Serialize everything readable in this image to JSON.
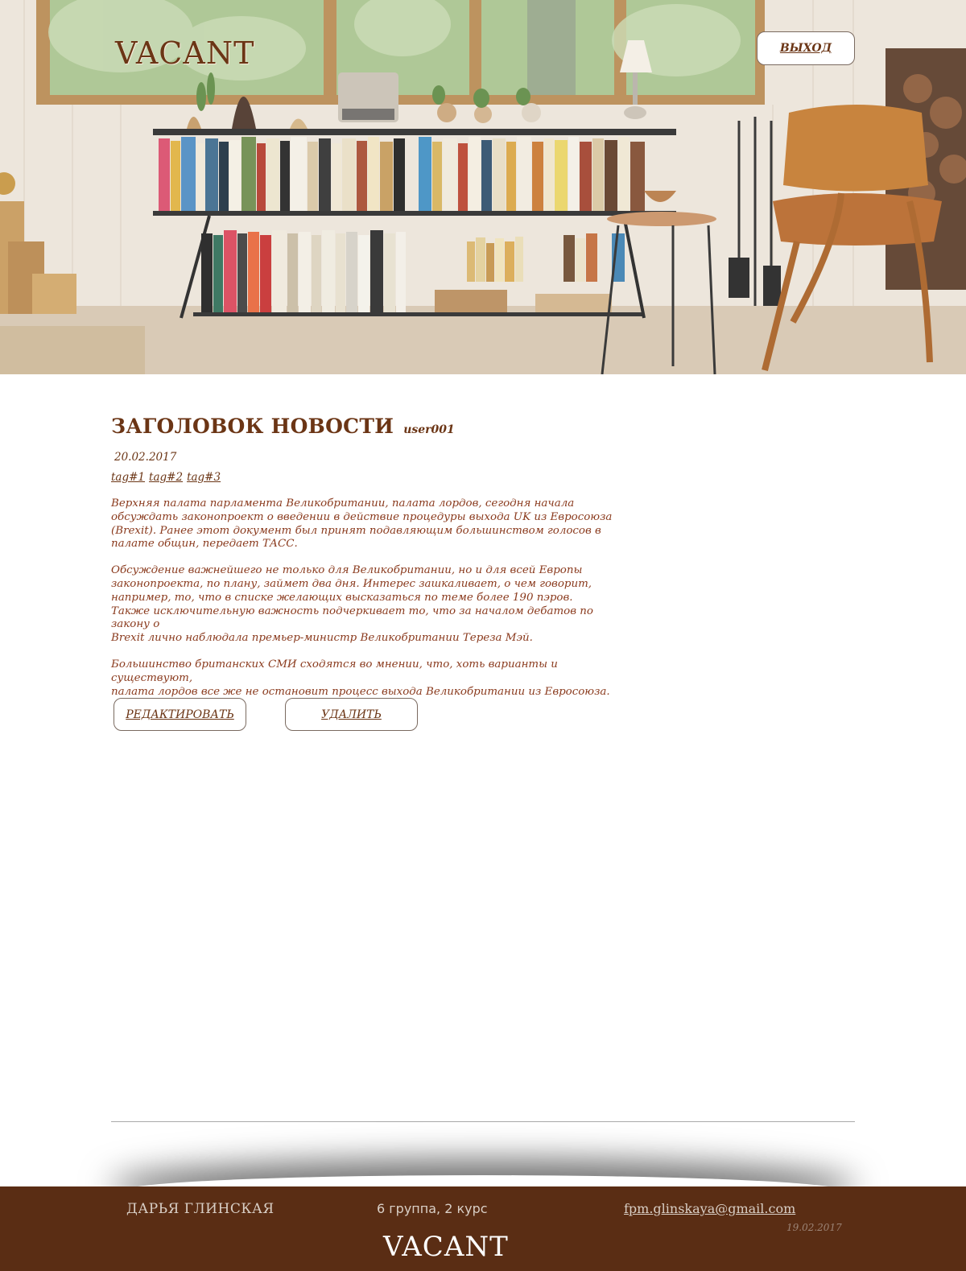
{
  "header": {
    "logo": "VACANT",
    "logout_label": "ВЫХОД"
  },
  "article": {
    "title": "ЗАГОЛОВОК НОВОСТИ",
    "author": "user001",
    "date": "20.02.2017",
    "tags": [
      "tag#1",
      "tag#2",
      "tag#3"
    ],
    "paragraphs": [
      "Верхняя палата парламента Великобритании, палата лордов, сегодня начала\nобсуждать законопроект о введении в действие процедуры выхода UK из Евросоюза\n(Brexit). Ранее этот документ был принят подавляющим большинством голосов в\nпалате общин, передает ТАСС.",
      "Обсуждение важнейшего не только для Великобритании, но и для всей Европы\nзаконопроекта, по плану, займет два дня. Интерес зашкаливает, о чем говорит,\nнапример, то, что в списке желающих высказаться по теме более 190 пэров.\nТакже исключительную важность подчеркивает то, что за началом дебатов по закону о\nBrexit лично наблюдала премьер-министр Великобритании Тереза Мэй.",
      "Большинство британских СМИ сходятся во мнении, что, хоть варианты и существуют,\nпалата лордов все же не остановит процесс выхода Великобритании из Евросоюза."
    ],
    "edit_label": "РЕДАКТИРОВАТЬ",
    "delete_label": "УДАЛИТЬ"
  },
  "footer": {
    "name": "ДАРЬЯ ГЛИНСКАЯ",
    "group": "6 группа, 2 курс",
    "email": "fpm.glinskaya@gmail.com",
    "date": "19.02.2017",
    "logo": "VACANT"
  },
  "colors": {
    "brand_brown": "#6b3515",
    "footer_bg": "#5a2d14"
  }
}
